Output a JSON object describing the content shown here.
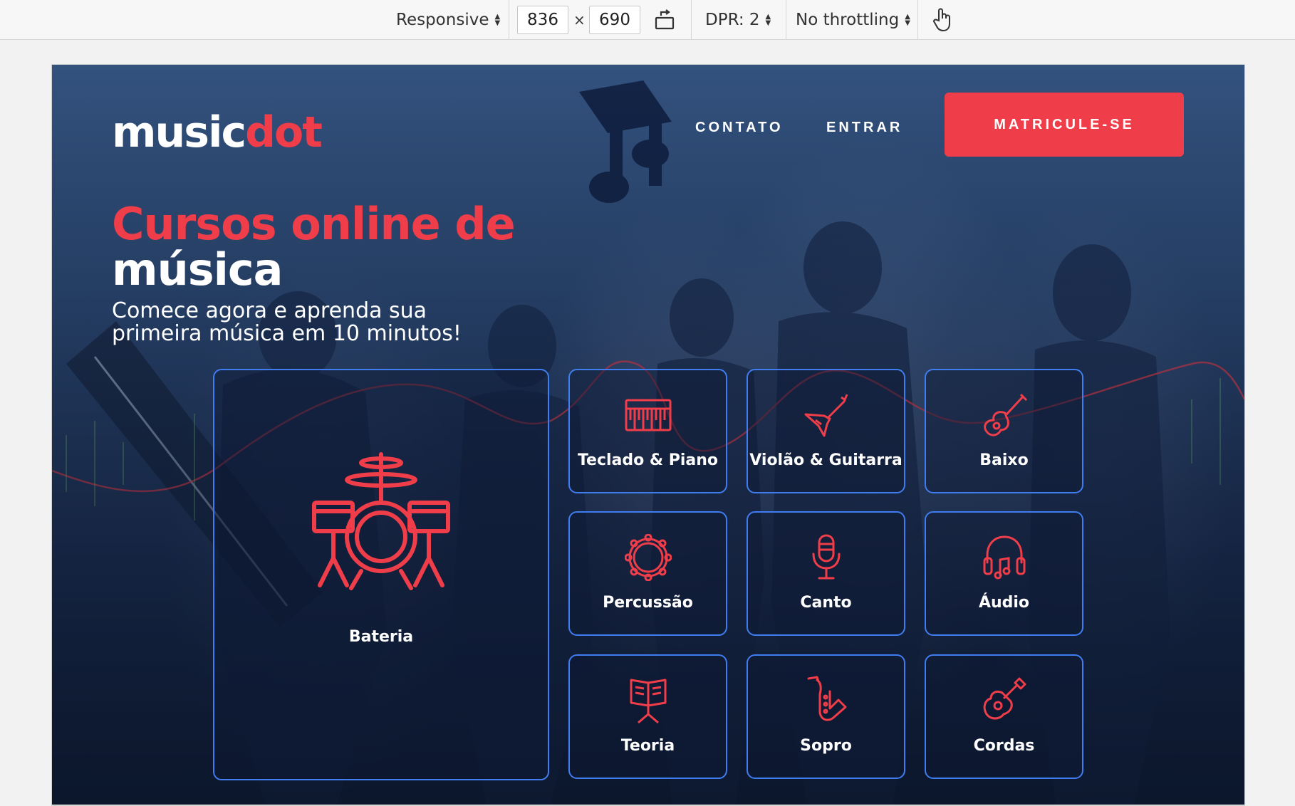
{
  "devtools": {
    "device": "Responsive",
    "width": "836",
    "height": "690",
    "times": "×",
    "dpr": "DPR: 2",
    "throttling": "No throttling"
  },
  "site": {
    "logo": {
      "text_main": "music",
      "text_accent": "dot"
    },
    "nav": {
      "contact": "CONTATO",
      "login": "ENTRAR",
      "cta": "MATRICULE-SE"
    },
    "hero": {
      "title_line1": "Cursos online de",
      "title_line2": "música",
      "subtitle_line1": "Comece agora e aprenda sua",
      "subtitle_line2": "primeira música em 10 minutos!"
    },
    "courses": [
      {
        "label": "Bateria",
        "icon": "drum-kit-icon"
      },
      {
        "label": "Teclado & Piano",
        "icon": "keyboard-icon"
      },
      {
        "label": "Violão & Guitarra",
        "icon": "electric-guitar-icon"
      },
      {
        "label": "Baixo",
        "icon": "bass-guitar-icon"
      },
      {
        "label": "Percussão",
        "icon": "tambourine-icon"
      },
      {
        "label": "Canto",
        "icon": "microphone-icon"
      },
      {
        "label": "Áudio",
        "icon": "headphones-icon"
      },
      {
        "label": "Teoria",
        "icon": "music-stand-icon"
      },
      {
        "label": "Sopro",
        "icon": "saxophone-icon"
      },
      {
        "label": "Cordas",
        "icon": "ukulele-icon"
      }
    ]
  },
  "colors": {
    "accent": "#ef3e4a",
    "card_border": "#3f7df0",
    "background_dark": "#1c2f52"
  }
}
